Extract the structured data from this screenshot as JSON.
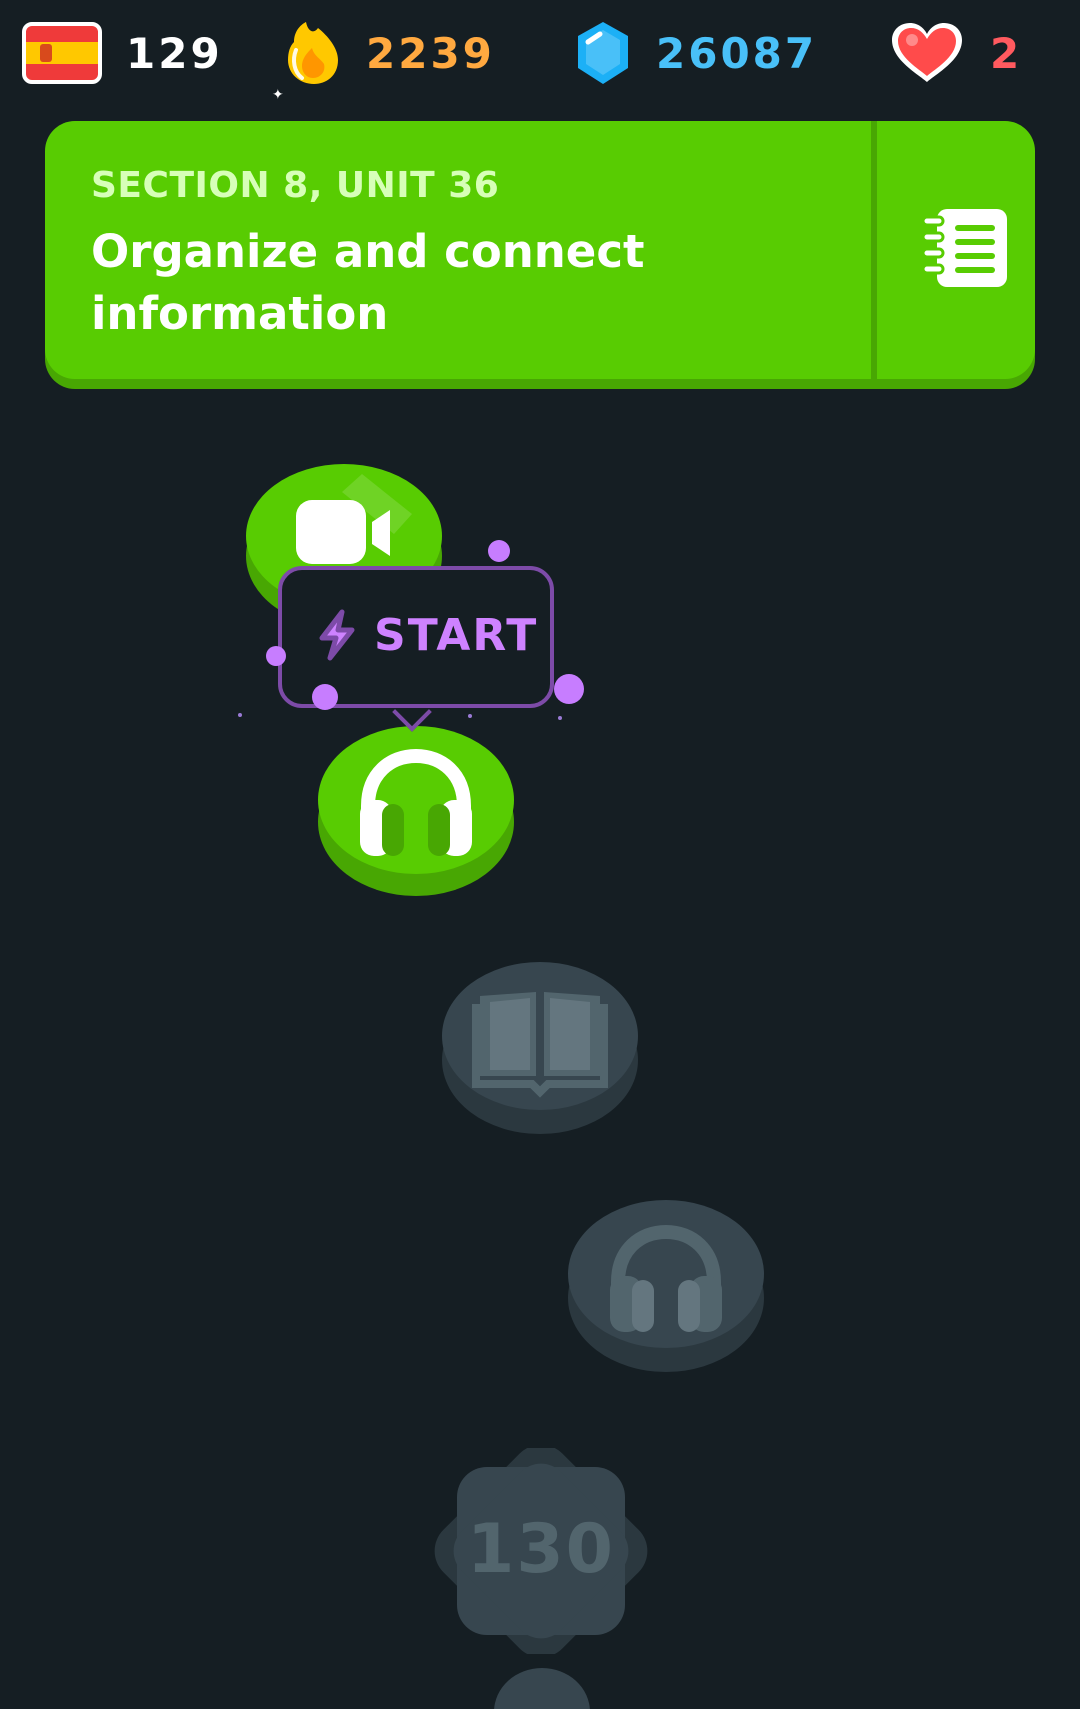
{
  "status_bar": {
    "language": {
      "flag_icon": "spain-flag-icon",
      "value": "129",
      "color": "#ffffff"
    },
    "streak": {
      "icon": "streak-flame-icon",
      "value": "2239",
      "color": "#ffa940"
    },
    "gems": {
      "icon": "gem-icon",
      "value": "26087",
      "color": "#49c0f8"
    },
    "hearts": {
      "icon": "heart-icon",
      "value": "2",
      "color": "#ff5a5f"
    }
  },
  "unit_banner": {
    "section": "SECTION 8, UNIT 36",
    "title": "Organize and connect information",
    "guide_icon": "guidebook-icon",
    "background": "#58cc02"
  },
  "tooltip": {
    "label": "START",
    "icon": "lightning-bolt-icon",
    "color": "#ce82ff"
  },
  "path": {
    "nodes": [
      {
        "icon": "video-camera-icon",
        "state": "completed"
      },
      {
        "icon": "headphones-icon",
        "state": "active"
      },
      {
        "icon": "book-icon",
        "state": "locked"
      },
      {
        "icon": "headphones-icon",
        "state": "locked"
      },
      {
        "icon": "level-badge",
        "state": "locked",
        "label": "130"
      }
    ]
  }
}
